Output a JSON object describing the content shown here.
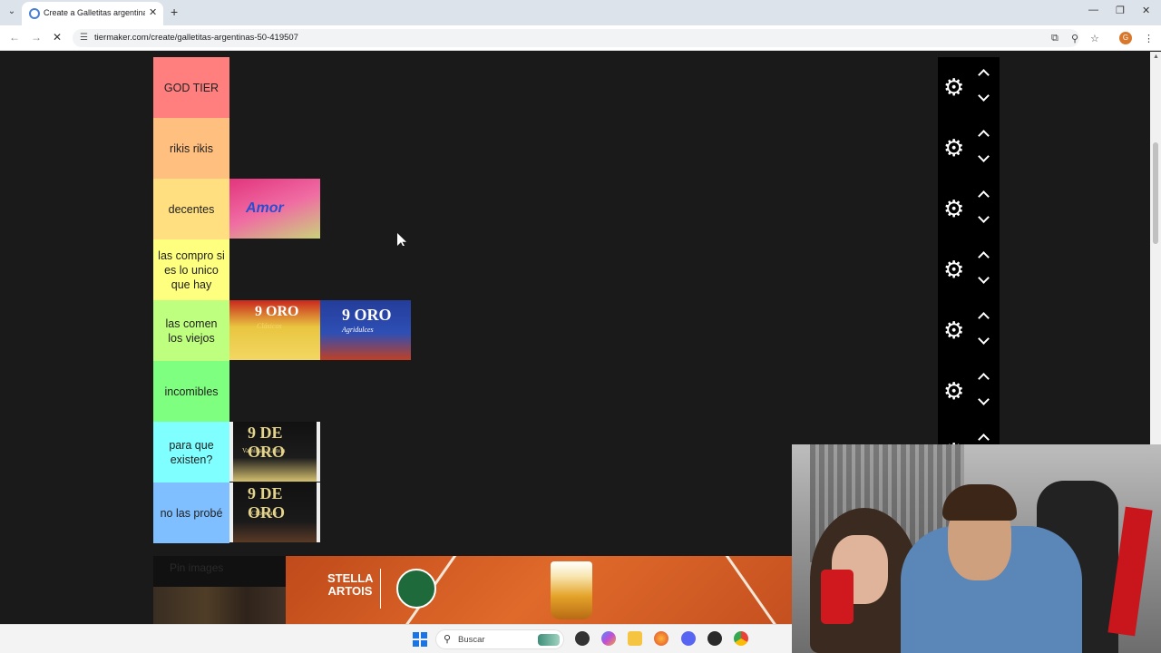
{
  "browser": {
    "tab_title": "Create a Galletitas argentinas [",
    "url": "tiermaker.com/create/galletitas-argentinas-50-419507",
    "profile_initial": "G"
  },
  "tiers": [
    {
      "label": "GOD TIER",
      "color": "#ff7f7f",
      "items": []
    },
    {
      "label": "rikis rikis",
      "color": "#ffbf7f",
      "items": []
    },
    {
      "label": "decentes",
      "color": "#ffdf7f",
      "items": [
        "amor"
      ]
    },
    {
      "label": "las compro si es lo unico que hay",
      "color": "#ffff7f",
      "items": []
    },
    {
      "label": "las comen los viejos",
      "color": "#bfff7f",
      "items": [
        "9-de-oro-clasicos",
        "9-de-oro-agridulces"
      ]
    },
    {
      "label": "incomibles",
      "color": "#7fff7f",
      "items": []
    },
    {
      "label": "para que existen?",
      "color": "#7fffff",
      "items": [
        "9-de-oro-vainilla-limon"
      ]
    },
    {
      "label": "no las probé",
      "color": "#7fbfff",
      "items": [
        "9-de-oro-chocolate"
      ]
    }
  ],
  "cookie_images": {
    "amor": {
      "text": "Amor"
    },
    "clasicos": {
      "brand": "9 ORO",
      "flavor": "Clásicos"
    },
    "agridulces": {
      "brand": "9 ORO",
      "flavor": "Agridulces"
    },
    "vainilla": {
      "brand": "9 DE ORO",
      "flavor": "Vainilla y Limón"
    },
    "chocolate": {
      "brand": "9 DE ORO",
      "flavor": "Chocolate"
    }
  },
  "pin_section": {
    "title": "Pin images"
  },
  "ad": {
    "brand": "STELLA ARTOIS"
  },
  "taskbar": {
    "search_label": "Buscar"
  },
  "colors": {
    "control_bg": "#000000",
    "page_bg": "#1a1a1a"
  }
}
